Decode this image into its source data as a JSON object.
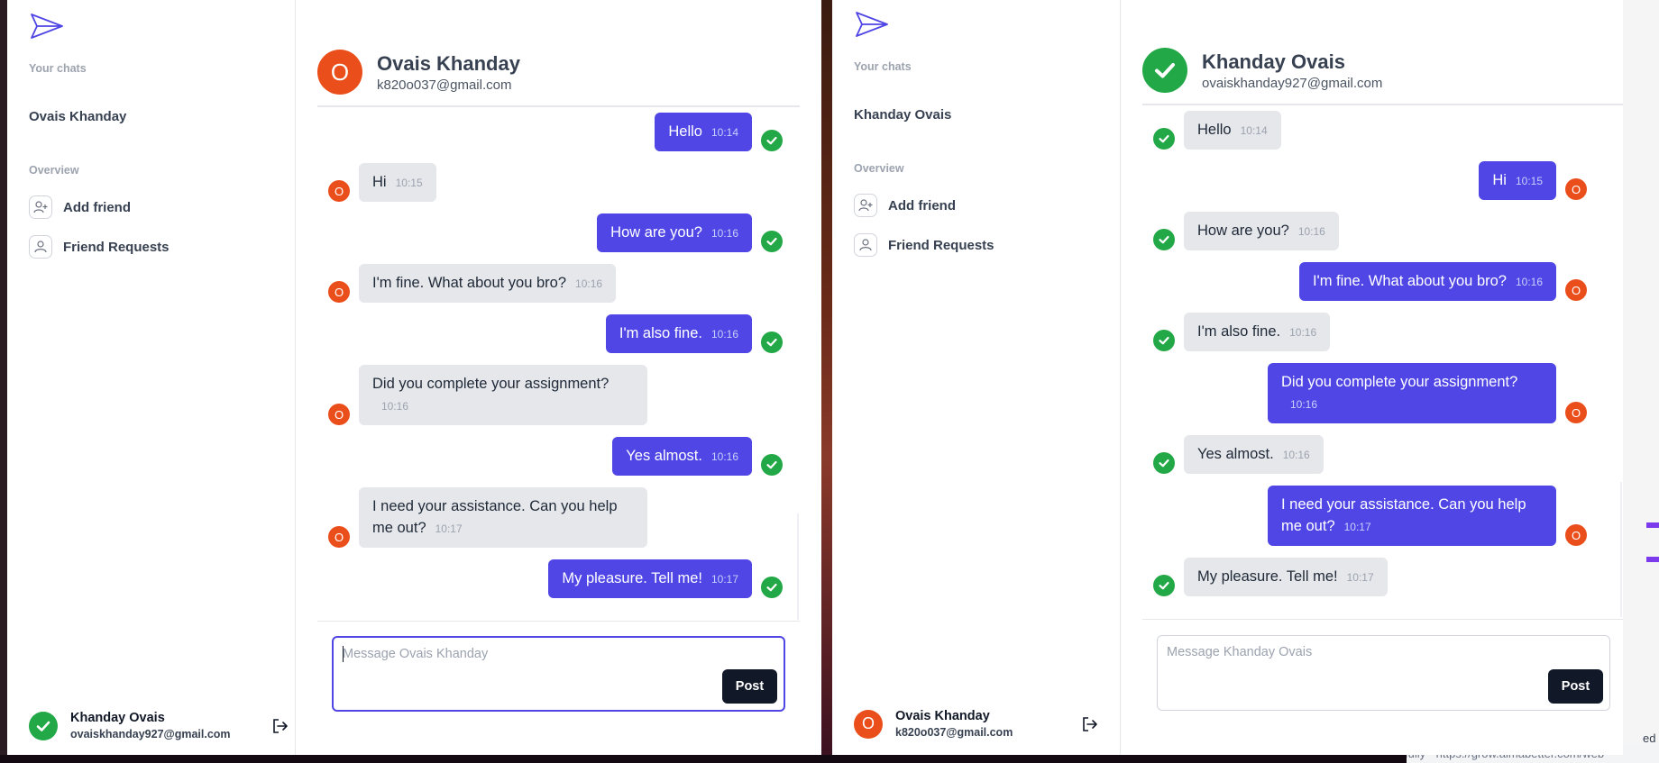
{
  "left_window": {
    "sidebar": {
      "your_chats_title": "Your chats",
      "chat_link": "Ovais Khanday",
      "overview_title": "Overview",
      "nav": [
        {
          "label": "Add friend",
          "icon": "user-plus-icon"
        },
        {
          "label": "Friend Requests",
          "icon": "user-icon"
        }
      ],
      "profile": {
        "name": "Khanday Ovais",
        "email": "ovaiskhanday927@gmail.com",
        "avatar": "check"
      }
    },
    "header": {
      "avatar_letter": "O",
      "name": "Ovais Khanday",
      "email": "k820o037@gmail.com"
    },
    "messages": [
      {
        "dir": "out",
        "text": "Hello",
        "time": "10:14"
      },
      {
        "dir": "in",
        "text": "Hi",
        "time": "10:15"
      },
      {
        "dir": "out",
        "text": "How are you?",
        "time": "10:16"
      },
      {
        "dir": "in",
        "text": "I'm fine. What about you bro?",
        "time": "10:16"
      },
      {
        "dir": "out",
        "text": "I'm also fine.",
        "time": "10:16"
      },
      {
        "dir": "in",
        "text": "Did you complete your assignment?",
        "time": "10:16"
      },
      {
        "dir": "out",
        "text": "Yes almost.",
        "time": "10:16"
      },
      {
        "dir": "in",
        "text": "I need your assistance. Can you help me out?",
        "time": "10:17"
      },
      {
        "dir": "out",
        "text": "My pleasure. Tell me!",
        "time": "10:17"
      }
    ],
    "composer": {
      "placeholder": "Message Ovais Khanday",
      "value": "",
      "post_label": "Post"
    }
  },
  "right_window": {
    "sidebar": {
      "your_chats_title": "Your chats",
      "chat_link": "Khanday Ovais",
      "overview_title": "Overview",
      "nav": [
        {
          "label": "Add friend",
          "icon": "user-plus-icon"
        },
        {
          "label": "Friend Requests",
          "icon": "user-icon"
        }
      ],
      "profile": {
        "name": "Ovais Khanday",
        "email": "k820o037@gmail.com",
        "avatar_letter": "O"
      }
    },
    "header": {
      "avatar": "check",
      "name": "Khanday Ovais",
      "email": "ovaiskhanday927@gmail.com"
    },
    "messages": [
      {
        "dir": "in",
        "text": "Hello",
        "time": "10:14"
      },
      {
        "dir": "out",
        "text": "Hi",
        "time": "10:15"
      },
      {
        "dir": "in",
        "text": "How are you?",
        "time": "10:16"
      },
      {
        "dir": "out",
        "text": "I'm fine. What about you bro?",
        "time": "10:16"
      },
      {
        "dir": "in",
        "text": "I'm also fine.",
        "time": "10:16"
      },
      {
        "dir": "out",
        "text": "Did you complete your assignment?",
        "time": "10:16"
      },
      {
        "dir": "in",
        "text": "Yes almost.",
        "time": "10:16"
      },
      {
        "dir": "out",
        "text": "I need your assistance. Can you help me out?",
        "time": "10:17"
      },
      {
        "dir": "in",
        "text": "My pleasure. Tell me!",
        "time": "10:17"
      }
    ],
    "composer": {
      "placeholder": "Message Khanday Ovais",
      "value": "",
      "post_label": "Post"
    }
  },
  "browser_status": {
    "url_text": "fully - https://grow.almabetter.com/web",
    "edge_text": "ed"
  },
  "colors": {
    "accent": "#4f46e5",
    "orange_avatar": "#ea4e1b",
    "green_avatar": "#22a846",
    "incoming_bubble": "#e5e7eb",
    "button_dark": "#111827"
  }
}
